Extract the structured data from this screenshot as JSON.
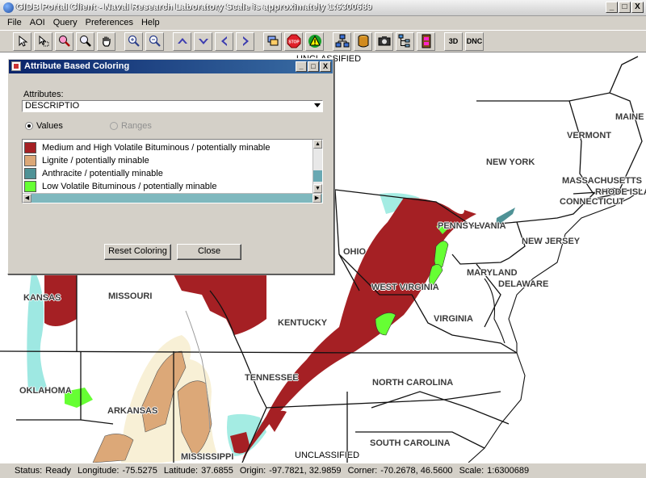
{
  "window": {
    "title": "GIDB Portal Client - Naval Research Laboratory    Scale is approximately 1:6300689",
    "minimize": "_",
    "maximize": "□",
    "close": "X"
  },
  "menu": [
    "File",
    "AOI",
    "Query",
    "Preferences",
    "Help"
  ],
  "toolbar": {
    "icons": [
      "select-arrow-icon",
      "select-region-icon",
      "zoom-region-icon",
      "zoom-tool-icon",
      "pan-hand-icon",
      "zoom-in-icon",
      "zoom-out-icon",
      "pan-up-icon",
      "pan-down-icon",
      "pan-left-icon",
      "pan-right-icon",
      "layers-icon",
      "stop-icon",
      "warning-icon",
      "network-icon",
      "database-icon",
      "camera-icon",
      "tree-icon",
      "film-icon"
    ],
    "label_3d": "3D",
    "label_dnc": "DNC"
  },
  "dialog": {
    "title": "Attribute Based Coloring",
    "attributes_label": "Attributes:",
    "attribute_value": "DESCRIPTIO",
    "radio_values": "Values",
    "radio_ranges": "Ranges",
    "items": [
      {
        "label": "Medium and High Volatile Bituminous / potentially minable",
        "color": "#a52024"
      },
      {
        "label": "Lignite / potentially minable",
        "color": "#dca878"
      },
      {
        "label": "Anthracite / potentially minable",
        "color": "#4f9296"
      },
      {
        "label": "Low Volatile Bituminous / potentially minable",
        "color": "#66ff33"
      }
    ],
    "reset_button": "Reset Coloring",
    "close_button": "Close"
  },
  "map": {
    "classification_top": "UNCLASSIFIED",
    "classification_bottom": "UNCLASSIFIED",
    "states": [
      {
        "name": "MAINE"
      },
      {
        "name": "VERMONT"
      },
      {
        "name": "NEW YORK"
      },
      {
        "name": "MASSACHUSETTS"
      },
      {
        "name": "RHODE ISLAND"
      },
      {
        "name": "CONNECTICUT"
      },
      {
        "name": "PENNSYLVANIA"
      },
      {
        "name": "NEW JERSEY"
      },
      {
        "name": "OHIO"
      },
      {
        "name": "MARYLAND"
      },
      {
        "name": "DELAWARE"
      },
      {
        "name": "WEST VIRGINIA"
      },
      {
        "name": "KANSAS"
      },
      {
        "name": "MISSOURI"
      },
      {
        "name": "KENTUCKY"
      },
      {
        "name": "VIRGINIA"
      },
      {
        "name": "TENNESSEE"
      },
      {
        "name": "NORTH CAROLINA"
      },
      {
        "name": "OKLAHOMA"
      },
      {
        "name": "ARKANSAS"
      },
      {
        "name": "MISSISSIPPI"
      },
      {
        "name": "SOUTH CAROLINA"
      }
    ]
  },
  "status": {
    "status_label": "Status:",
    "status_value": "Ready",
    "longitude_label": "Longitude:",
    "longitude_value": "-75.5275",
    "latitude_label": "Latitude:",
    "latitude_value": "37.6855",
    "origin_label": "Origin:",
    "origin_value": "-97.7821, 32.9859",
    "corner_label": "Corner:",
    "corner_value": "-70.2678, 46.5600",
    "scale_label": "Scale:",
    "scale_value": "1:6300689"
  }
}
